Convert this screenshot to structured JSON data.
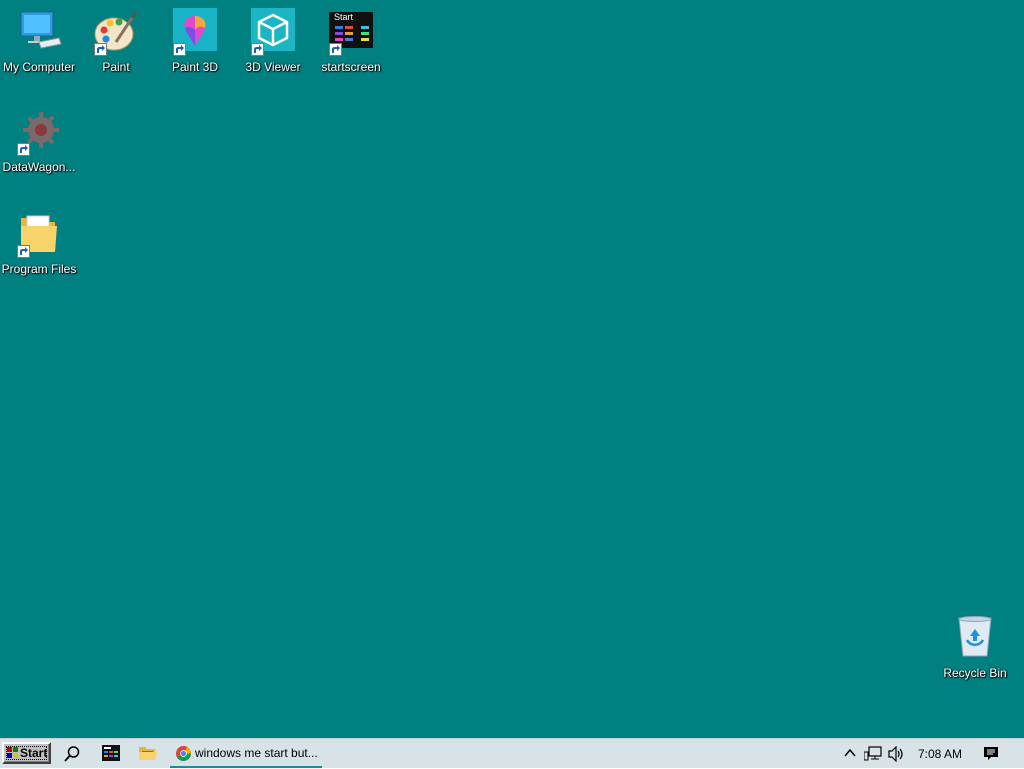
{
  "desktop": {
    "background": "#008080",
    "icons": [
      {
        "label": "My Computer",
        "icon": "computer-icon"
      },
      {
        "label": "Paint",
        "icon": "paint-palette-icon"
      },
      {
        "label": "Paint 3D",
        "icon": "paint3d-icon"
      },
      {
        "label": "3D Viewer",
        "icon": "3d-viewer-icon"
      },
      {
        "label": "startscreen",
        "icon": "startscreen-icon",
        "thumb_text": "Start"
      },
      {
        "label": "DataWagon...",
        "icon": "datawagon-gear-icon"
      },
      {
        "label": "Program Files",
        "icon": "folder-icon"
      },
      {
        "label": "Recycle Bin",
        "icon": "recycle-bin-icon"
      }
    ]
  },
  "taskbar": {
    "start_label": "Start",
    "task_chrome_label": "windows me start but...",
    "clock": "7:08 AM",
    "accent": "#1a8c9c"
  }
}
